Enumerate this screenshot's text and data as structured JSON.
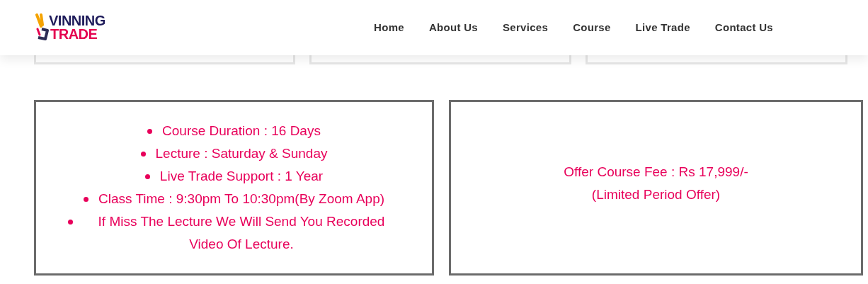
{
  "header": {
    "logo": {
      "top": "VINNING",
      "bottom": "TRADE"
    },
    "nav": [
      {
        "label": "Home"
      },
      {
        "label": "About Us"
      },
      {
        "label": "Services"
      },
      {
        "label": "Course"
      },
      {
        "label": "Live Trade"
      },
      {
        "label": "Contact Us"
      }
    ]
  },
  "course_details": {
    "items": [
      "Course Duration : 16 Days",
      "Lecture : Saturday & Sunday",
      "Live Trade Support : 1 Year",
      "Class Time : 9:30pm To 10:30pm(By Zoom App)",
      "If Miss The Lecture We Will Send You Recorded Video Of Lecture."
    ]
  },
  "fee": {
    "lines": [
      "Offer Course Fee : Rs 17,999/-",
      "(Limited Period Offer)"
    ]
  }
}
